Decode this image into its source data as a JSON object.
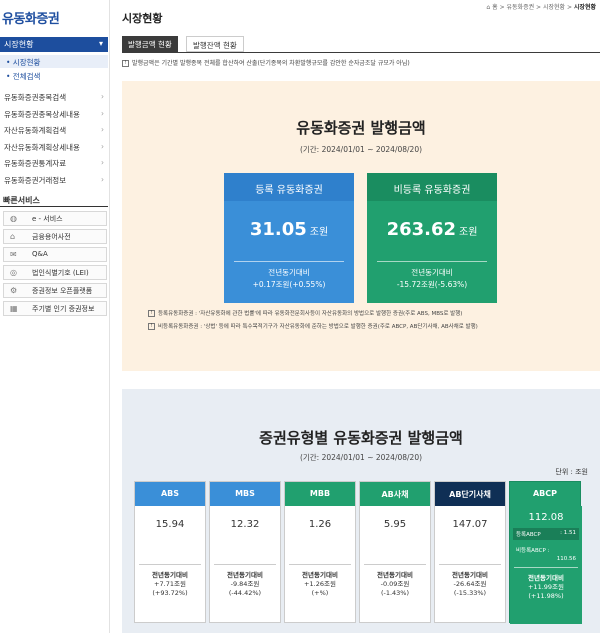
{
  "sidebar": {
    "logo": "유동화증권",
    "section": "시장현황",
    "sub_items": [
      "• 시장현황",
      "• 전체검색"
    ],
    "menu": [
      "유동화증권종목검색",
      "유동화증권종목상세내용",
      "자산유동화계획검색",
      "자산유동화계획상세내용",
      "유동화증권통계자료",
      "유동화증권거래정보"
    ],
    "quick_title": "빠른서비스",
    "quick": [
      "e - 서비스",
      "금융용어사전",
      "Q&A",
      "법인식별기호 (LEI)",
      "증권정보 오픈플랫폼",
      "주기별 인기 증권정보"
    ],
    "quick_icons": [
      "globe-icon",
      "hat-icon",
      "qa-icon",
      "lei-icon",
      "api-icon",
      "chart-icon"
    ]
  },
  "header": {
    "title": "시장현황",
    "breadcrumb": [
      "홈",
      "유동화증권",
      "시장현황",
      "시장현황"
    ]
  },
  "tabs": [
    "발행금액 현황",
    "발행잔액 현황"
  ],
  "notice": "발행금액은 기간별 발행종목 전체를 합산하여 산출(단기종목의 차환발행규모를 감안한 순자금조달 규모가 아님)",
  "panel1": {
    "title": "유동화증권 발행금액",
    "period": "(기간: 2024/01/01 ~ 2024/08/20)",
    "cards": [
      {
        "title": "등록 유동화증권",
        "value": "31.05",
        "unit": "조원",
        "compare_label": "전년동기대비",
        "compare": "+0.17조원(+0.55%)"
      },
      {
        "title": "비등록 유동화증권",
        "value": "263.62",
        "unit": "조원",
        "compare_label": "전년동기대비",
        "compare": "-15.72조원(-5.63%)"
      }
    ],
    "notes": [
      "등록유동화증권 : '자산유동화에 관한 법률'에 따라 유동화전문회사등이 자산유동화의 방법으로 발행한 증권(주로 ABS, MBS로 발행)",
      "비등록유동화증권 : '상법' 등에 따라 특수목적기구가 자산유동화에 준하는 방법으로 발행한 증권(주로 ABCP, AB단기사채, AB사채로 발행)"
    ]
  },
  "panel2": {
    "title": "증권유형별 유동화증권 발행금액",
    "period": "(기간: 2024/01/01 ~ 2024/08/20)",
    "unit_label": "단위 : 조원",
    "cards": [
      {
        "title": "ABS",
        "value": "15.94",
        "compare_label": "전년동기대비",
        "compare1": "+7.71조원",
        "compare2": "(+93.72%)"
      },
      {
        "title": "MBS",
        "value": "12.32",
        "compare_label": "전년동기대비",
        "compare1": "-9.84조원",
        "compare2": "(-44.42%)"
      },
      {
        "title": "MBB",
        "value": "1.26",
        "compare_label": "전년동기대비",
        "compare1": "+1.26조원",
        "compare2": "(+%)"
      },
      {
        "title": "AB사채",
        "value": "5.95",
        "compare_label": "전년동기대비",
        "compare1": "-0.09조원",
        "compare2": "(-1.43%)"
      },
      {
        "title": "AB단기사채",
        "value": "147.07",
        "compare_label": "전년동기대비",
        "compare1": "-26.64조원",
        "compare2": "(-15.33%)"
      }
    ],
    "abcp": {
      "title": "ABCP",
      "value": "112.08",
      "registered_label": "등록ABCP",
      "registered_value": ": 1.51",
      "unregistered_label": "비등록ABCP :",
      "unregistered_value": "110.56",
      "compare_label": "전년동기대비",
      "compare1": "+11.99조원",
      "compare2": "(+11.98%)"
    }
  },
  "colors": {
    "blue": "#3a8fd8",
    "green": "#21a06f",
    "navy": "#0f2f55",
    "sidebar_head": "#1d4e9e",
    "panel1_bg": "#fdf1e1",
    "panel2_bg": "#e8edf3"
  }
}
